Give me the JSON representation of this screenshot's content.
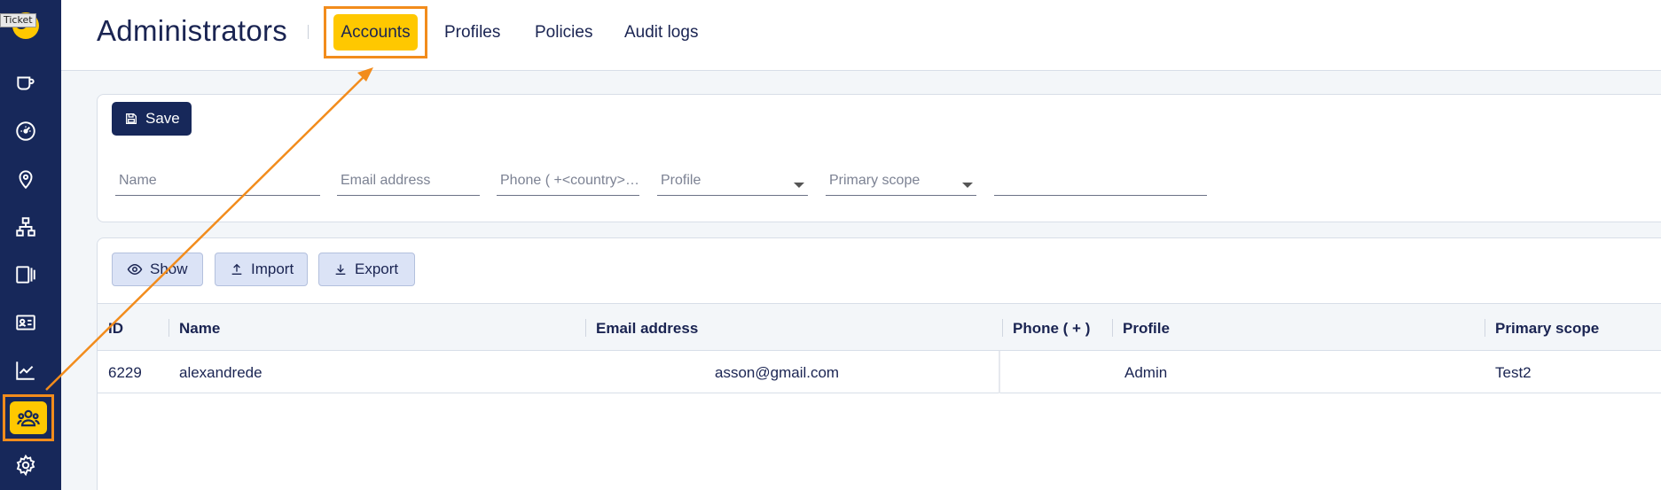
{
  "sidebar": {
    "tooltip": "Ticket",
    "items": [
      {
        "icon": "cup-icon"
      },
      {
        "icon": "dashboard-gauge-icon"
      },
      {
        "icon": "location-pin-icon"
      },
      {
        "icon": "network-icon"
      },
      {
        "icon": "devices-icon"
      },
      {
        "icon": "id-card-icon"
      },
      {
        "icon": "chart-line-icon"
      },
      {
        "icon": "users-icon",
        "active": true
      },
      {
        "icon": "gear-icon"
      }
    ]
  },
  "header": {
    "title": "Administrators",
    "tabs": [
      {
        "label": "Accounts",
        "active": true
      },
      {
        "label": "Profiles"
      },
      {
        "label": "Policies"
      },
      {
        "label": "Audit logs"
      }
    ]
  },
  "filters": {
    "save_label": "Save",
    "name_placeholder": "Name",
    "email_placeholder": "Email address",
    "phone_placeholder": "Phone ( +<country>…",
    "profile_placeholder": "Profile",
    "scope_placeholder": "Primary scope"
  },
  "toolbar": {
    "show_label": "Show",
    "import_label": "Import",
    "export_label": "Export"
  },
  "table": {
    "headers": {
      "id": "ID",
      "name": "Name",
      "email": "Email address",
      "phone": "Phone ( + )",
      "profile": "Profile",
      "scope": "Primary scope"
    },
    "rows": [
      {
        "id": "6229",
        "name": "alexandrede",
        "email": "asson@gmail.com",
        "phone": "",
        "profile": "Admin",
        "scope": "Test2"
      }
    ]
  },
  "colors": {
    "sidebar": "#17285a",
    "accent": "#ffc800",
    "annotation": "#f28c1c"
  }
}
